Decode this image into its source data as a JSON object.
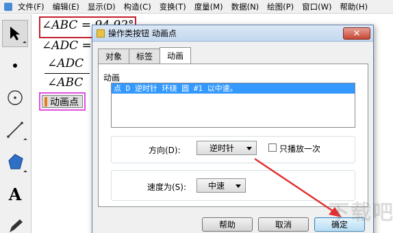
{
  "menubar": {
    "items": [
      "文件(F)",
      "编辑(E)",
      "显示(D)",
      "构造(C)",
      "变换(T)",
      "度量(M)",
      "数据(N)",
      "绘图(P)",
      "窗口(W)",
      "帮助(H)"
    ]
  },
  "toolbox": {
    "tools": [
      "arrow-select-tool",
      "point-tool",
      "compass-tool",
      "straightedge-tool",
      "polygon-tool",
      "text-tool",
      "marker-tool"
    ],
    "text_tool_glyph": "A"
  },
  "canvas": {
    "measures": [
      "∠ABC = 94.92°",
      "∠ADC =",
      "∠ADC",
      "∠ABC"
    ],
    "animate_button_label": "动画点"
  },
  "dialog": {
    "title": "操作类按钮 动画点",
    "close_label": "✕",
    "tabs": [
      "对象",
      "标签",
      "动画"
    ],
    "active_tab": "动画",
    "animation_group_label": "动画",
    "animation_list": [
      "点 D 逆时针 环绕 圆 #1 以中速。"
    ],
    "direction_label": "方向(D):",
    "direction_value": "逆时针",
    "play_once_label": "只播放一次",
    "play_once_checked": false,
    "speed_label": "速度为(S):",
    "speed_value": "中速",
    "buttons": {
      "help": "帮助",
      "cancel": "取消",
      "ok": "确定"
    }
  },
  "colors": {
    "highlight_box": "#c21d2b",
    "button_highlight": "#e04de0",
    "arrow": "#e03030",
    "selection": "#3399ff"
  },
  "watermark": "下载吧"
}
